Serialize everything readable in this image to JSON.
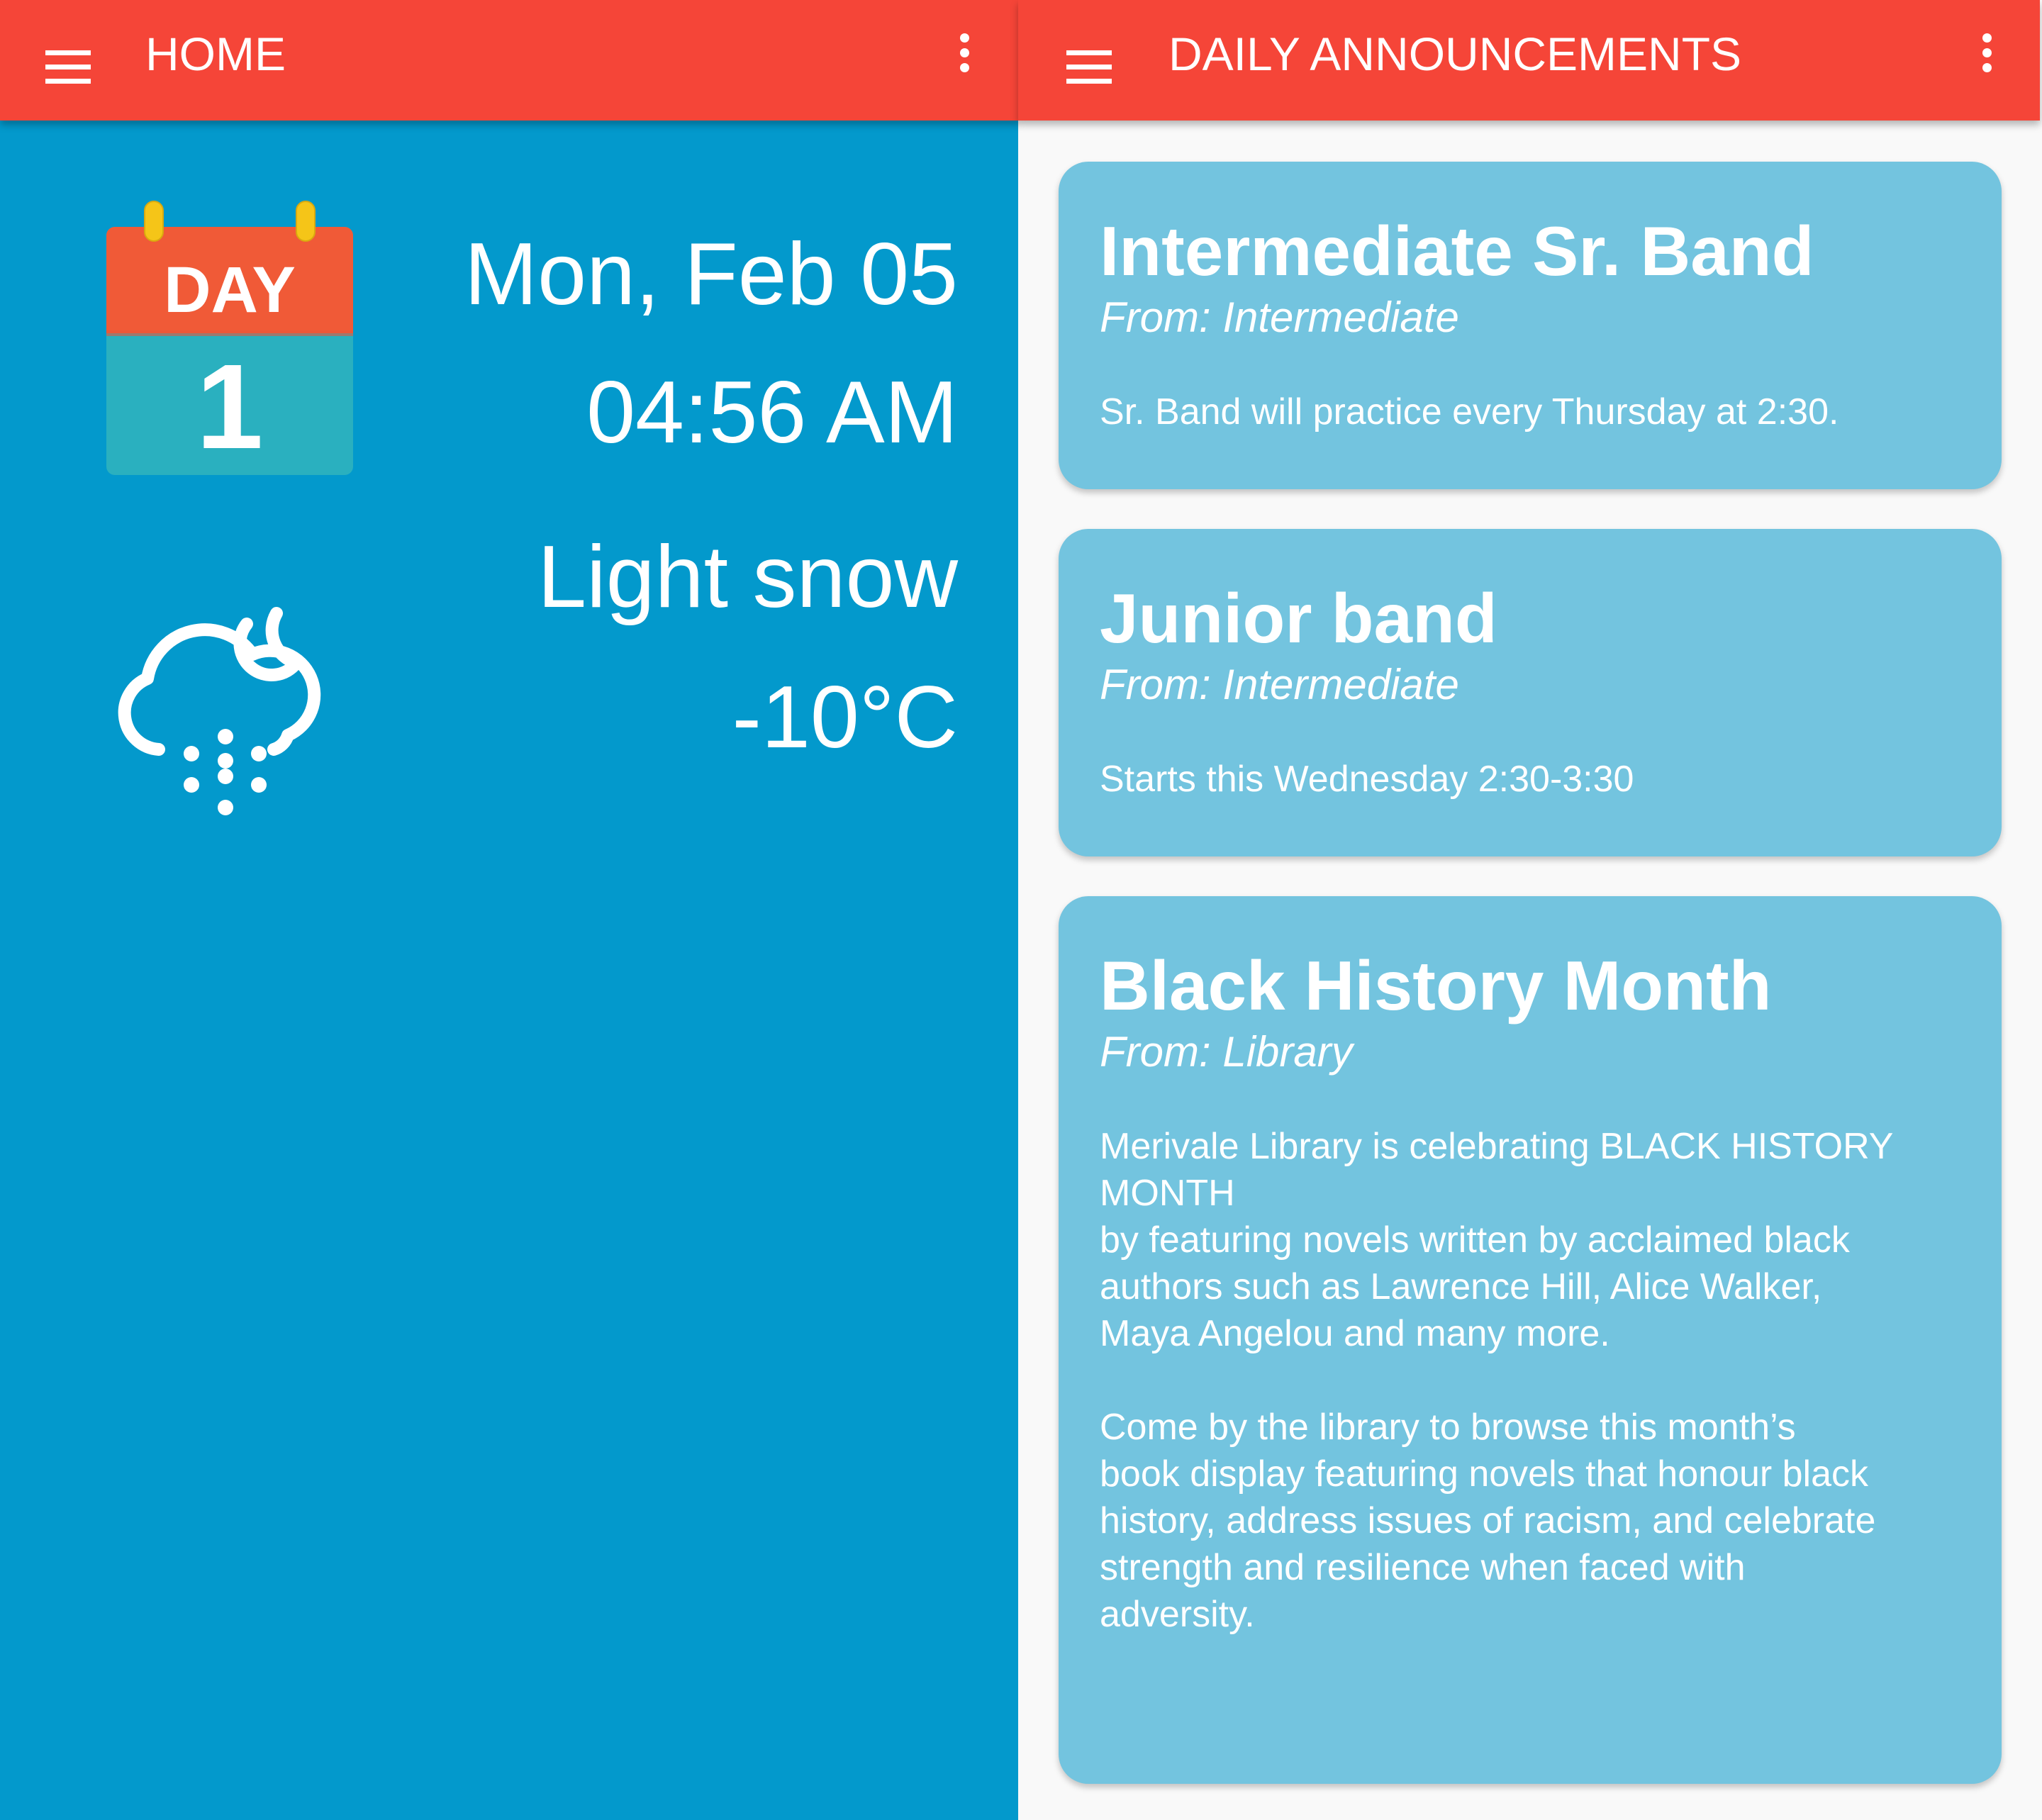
{
  "home": {
    "title": "HOME",
    "day_badge": {
      "label": "DAY",
      "number": "1"
    },
    "date": "Mon, Feb 05",
    "time": "04:56 AM",
    "weather": {
      "condition": "Light snow",
      "temperature": "-10°C",
      "icon": "snow-cloud-moon-icon"
    }
  },
  "announcements": {
    "title": "DAILY ANNOUNCEMENTS",
    "items": [
      {
        "title": "Intermediate Sr. Band",
        "from": "From: Intermediate",
        "body": "Sr. Band will practice every Thursday at 2:30."
      },
      {
        "title": "Junior band",
        "from": "From: Intermediate",
        "body": "Starts this Wednesday 2:30-3:30"
      },
      {
        "title": "Black History Month",
        "from": "From: Library",
        "body": "Merivale Library is celebrating BLACK HISTORY\nMONTH\nby featuring novels written by acclaimed black\nauthors such as Lawrence Hill, Alice Walker,\nMaya Angelou and many more.\n\nCome by the library to browse this month’s\nbook display featuring novels that honour black\nhistory, address issues of racism, and celebrate\nstrength and resilience when faced with\nadversity."
      }
    ]
  },
  "icons": {
    "menu": "hamburger-menu-icon",
    "overflow": "more-vert-icon"
  },
  "colors": {
    "app_bar": "#f54538",
    "home_background": "#0399cc",
    "card_background": "#73c4df",
    "list_background": "#f9f9f9",
    "calendar_top": "#f05a37",
    "calendar_bottom": "#2ab0bf",
    "calendar_rings": "#f5c518"
  }
}
